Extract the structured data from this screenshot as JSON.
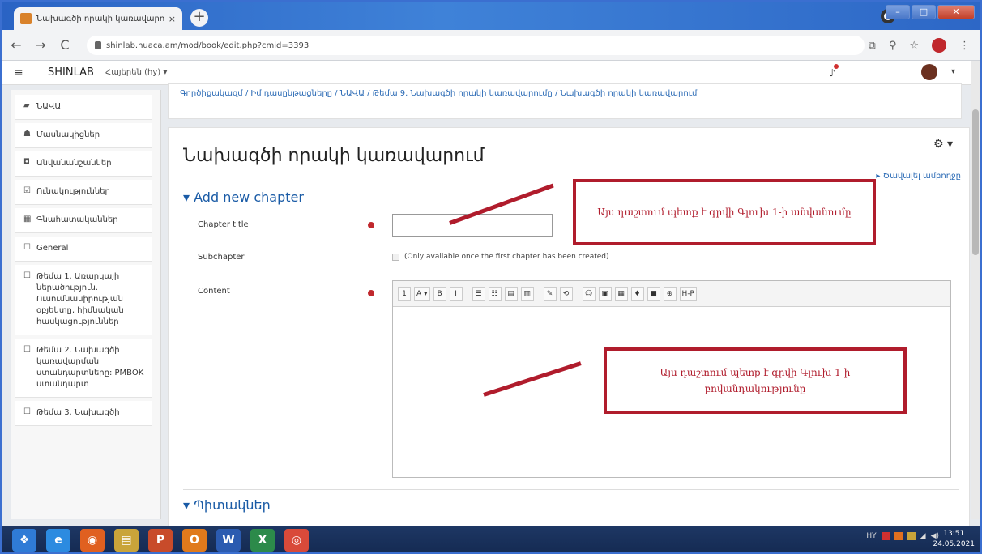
{
  "browser": {
    "tab_title": "Նախագծի որակի կառավարում",
    "tab_close": "×",
    "new_tab": "+",
    "url": "shinlab.nuaca.am/mod/book/edit.php?cmid=3393",
    "back": "←",
    "forward": "→",
    "reload": "C"
  },
  "navbar": {
    "menu_icon": "≡",
    "brand": "SHINLAB",
    "language": "Հայերեն (hy) ▾",
    "user_caret": "▾"
  },
  "sidebar": {
    "items": [
      {
        "icon": "graduation-cap-icon",
        "glyph": "▰",
        "label": "ՆԱՎԱ"
      },
      {
        "icon": "users-icon",
        "glyph": "☗",
        "label": "Մասնակիցներ"
      },
      {
        "icon": "badge-icon",
        "glyph": "◘",
        "label": "Անվանանշաններ"
      },
      {
        "icon": "competencies-icon",
        "glyph": "☑",
        "label": "Ունակություններ"
      },
      {
        "icon": "grades-icon",
        "glyph": "▦",
        "label": "Գնահատականներ"
      },
      {
        "icon": "folder-icon",
        "glyph": "☐",
        "label": "General"
      },
      {
        "icon": "folder-icon",
        "glyph": "☐",
        "label": "Թեմա 1. Առարկայի ներածություն. Ուսումնասիրության օբյեկտը, հիմնական հասկացություններ"
      },
      {
        "icon": "folder-icon",
        "glyph": "☐",
        "label": "Թեմա 2. Նախագծի կառավարման ստանդարտները: PMBOK ստանդարտ"
      },
      {
        "icon": "folder-icon",
        "glyph": "☐",
        "label": "Թեմա 3. Նախագծի"
      }
    ]
  },
  "breadcrumb": "Գործիքակազմ / Իմ դասընթացները / ՆԱՎԱ / Թեմա 9. Նախագծի որակի կառավարումը / Նախագծի որակի կառավարում",
  "main": {
    "page_title": "Նախագծի որակի կառավարում",
    "gear": "⚙ ▾",
    "expand_all": "▸ Ծավալել ամբողջը",
    "section_add": "Add new chapter",
    "chapter_title_label": "Chapter title",
    "subchapter_label": "Subchapter",
    "subchapter_note": "(Only available once the first chapter has been created)",
    "content_label": "Content",
    "section_tags": "Պիտակներ",
    "toolbar": [
      "1",
      "A ▾",
      "B",
      "I",
      "☰",
      "☷",
      "▤",
      "▥",
      "✎",
      "⟲",
      "☺",
      "▣",
      "▦",
      "♦",
      "■",
      "⊕",
      "H-P"
    ]
  },
  "annotations": {
    "title_note": "Այս դաշտում պետք է գրվի Գլուխ 1-ի անվանումը",
    "content_note": "Այս դաշտում պետք է գրվի Գլուխ 1-ի բովանդակությունը",
    "color": "#b01c2c"
  },
  "taskbar": {
    "apps": [
      {
        "icon": "start-icon",
        "glyph": "❖",
        "color": "#2f7bd6"
      },
      {
        "icon": "ie-icon",
        "glyph": "e",
        "color": "#2c8be0"
      },
      {
        "icon": "firefox-icon",
        "glyph": "◉",
        "color": "#e06020"
      },
      {
        "icon": "explorer-icon",
        "glyph": "▤",
        "color": "#c9a43a"
      },
      {
        "icon": "powerpoint-icon",
        "glyph": "P",
        "color": "#c84b2a"
      },
      {
        "icon": "outlook-icon",
        "glyph": "O",
        "color": "#e07a1c"
      },
      {
        "icon": "word-icon",
        "glyph": "W",
        "color": "#2b5bb0"
      },
      {
        "icon": "excel-icon",
        "glyph": "X",
        "color": "#2c8a4a"
      },
      {
        "icon": "chrome-icon",
        "glyph": "◎",
        "color": "#d94a3a"
      }
    ],
    "lang": "HY",
    "time": "13:51",
    "date": "24.05.2021"
  }
}
